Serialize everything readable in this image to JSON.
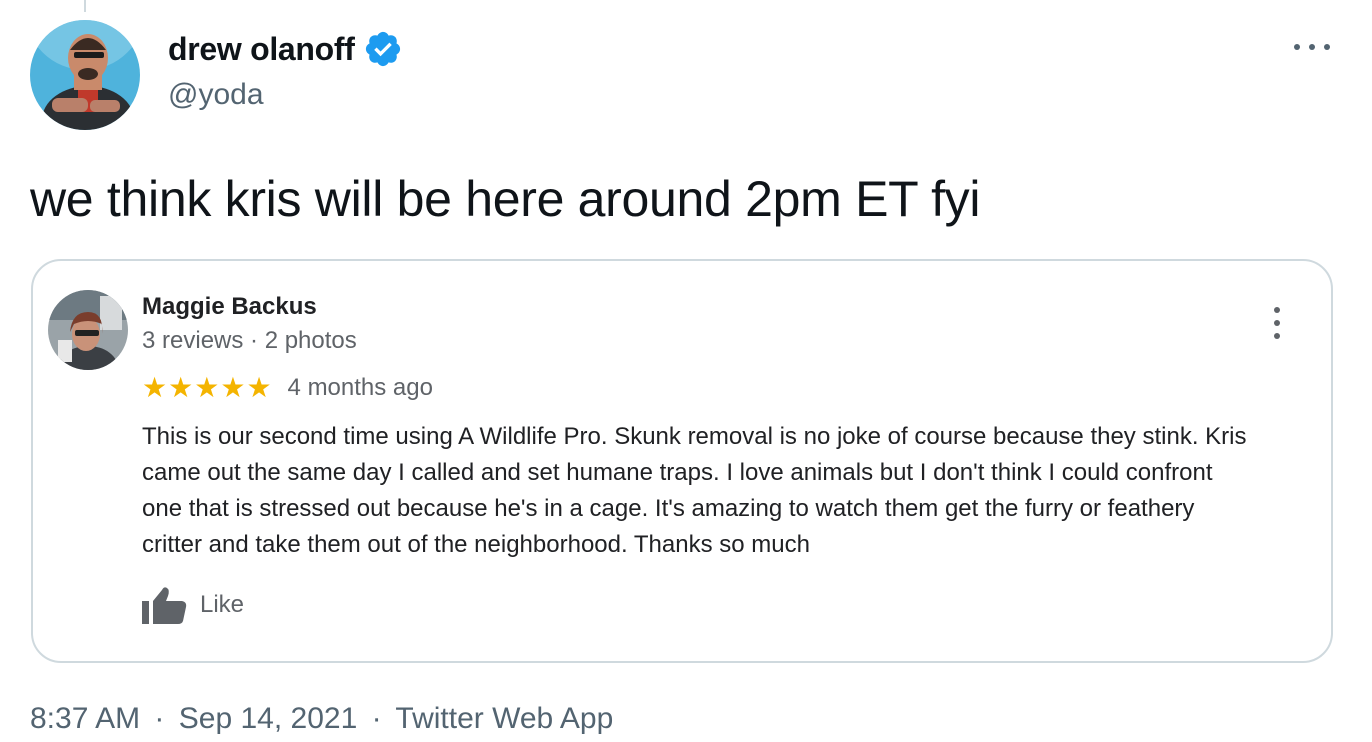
{
  "tweet": {
    "author": {
      "name": "drew olanoff",
      "handle": "@yoda",
      "verified": true,
      "avatar_icon": "user-avatar-photo",
      "verified_icon": "verified-badge-icon"
    },
    "more_icon": "more-horizontal-icon",
    "text": "we think kris will be here around 2pm ET fyi",
    "meta": {
      "time": "8:37 AM",
      "separator": "·",
      "date": "Sep 14, 2021",
      "source": "Twitter Web App"
    }
  },
  "review": {
    "reviewer_name": "Maggie Backus",
    "reviewer_meta": "3 reviews · 2 photos",
    "avatar_icon": "reviewer-avatar-photo",
    "menu_icon": "more-vertical-icon",
    "rating": 5,
    "rating_max": 5,
    "star_glyph": "★",
    "time": "4 months ago",
    "body_lines": [
      "This is our second time using A Wildlife Pro.  Skunk removal is no joke of course because they stink. Kris",
      "came out the same day I called and set humane traps.  I love animals but I don't think I could confront",
      "one that is stressed out because he's in a cage.  It's amazing to watch them get the furry or feathery",
      "critter and take them out of the neighborhood.  Thanks so much"
    ],
    "like_label": "Like",
    "like_icon": "thumbs-up-icon"
  },
  "colors": {
    "verified_blue": "#1d9bf0",
    "star_yellow": "#f4b400",
    "secondary_text": "#536471",
    "border": "#cfd9de"
  }
}
